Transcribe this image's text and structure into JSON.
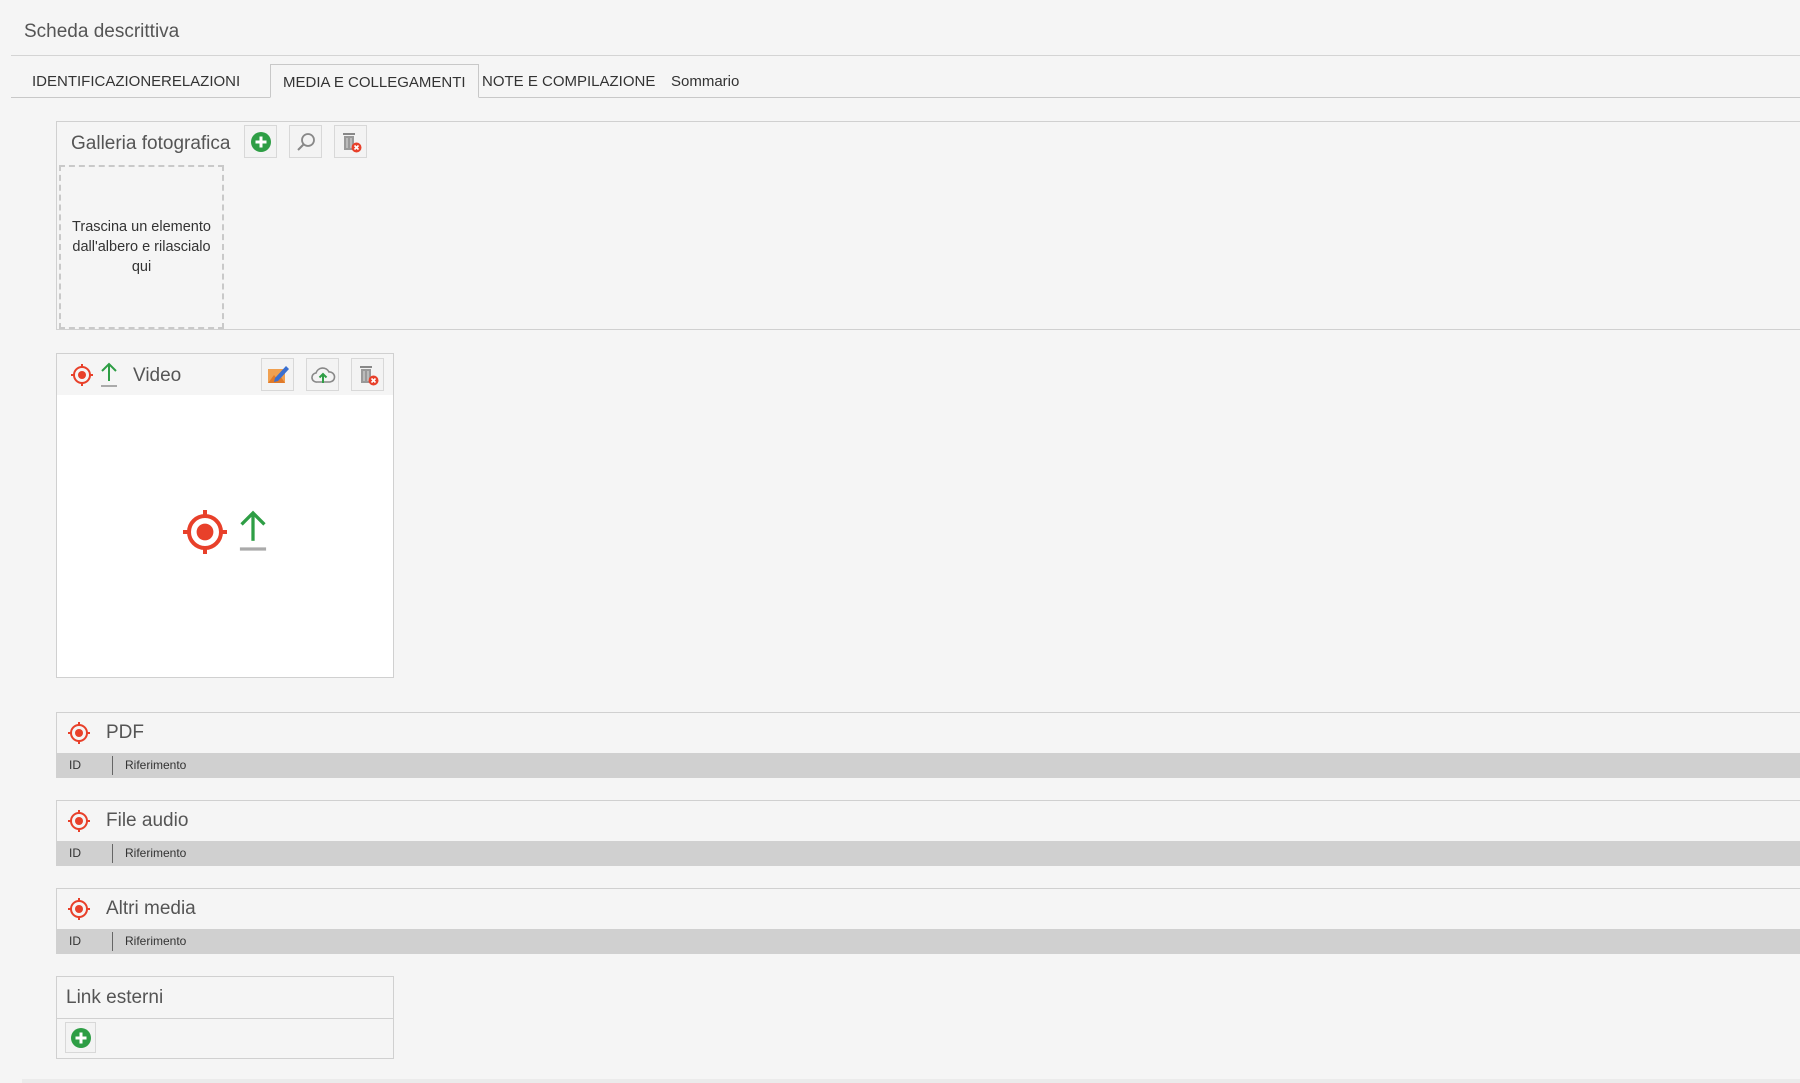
{
  "page": {
    "title": "Scheda descrittiva"
  },
  "tabs": [
    {
      "label": "IDENTIFICAZIONE"
    },
    {
      "label": "RELAZIONI"
    },
    {
      "label": "MEDIA E COLLEGAMENTI",
      "active": true
    },
    {
      "label": "NOTE E COMPILAZIONE"
    },
    {
      "label": "Sommario"
    }
  ],
  "gallery": {
    "title": "Galleria fotografica",
    "tools": [
      "add-icon",
      "search-icon",
      "trash-delete-icon"
    ],
    "dropzone_text": "Trascina un elemento\ndall'albero e rilascialo\nqui"
  },
  "video": {
    "title": "Video",
    "header_icons": [
      "target-icon",
      "upload-arrow-icon"
    ],
    "tools": [
      "edit-image-icon",
      "cloud-upload-icon",
      "trash-delete-icon"
    ]
  },
  "pdf": {
    "title": "PDF",
    "columns": [
      "ID",
      "Riferimento"
    ]
  },
  "audio": {
    "title": "File audio",
    "columns": [
      "ID",
      "Riferimento"
    ]
  },
  "other_media": {
    "title": "Altri media",
    "columns": [
      "ID",
      "Riferimento"
    ]
  },
  "links": {
    "title": "Link esterni",
    "add_icon": "add-icon"
  },
  "colors": {
    "accent_green": "#2e9e45",
    "target_red": "#e8402a",
    "border": "#d0d0d0",
    "table_header": "#d0d0d0"
  }
}
